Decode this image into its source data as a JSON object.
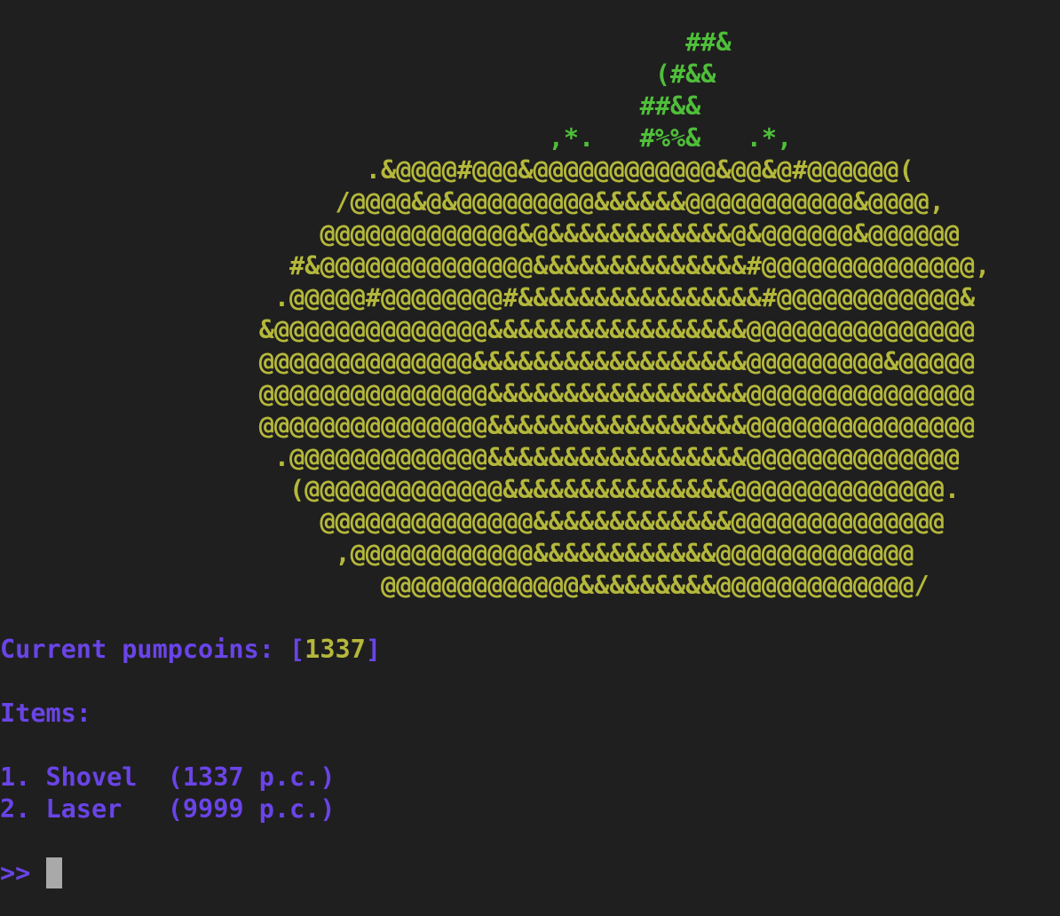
{
  "ascii_art": {
    "stem_lines": [
      "                                             ##&",
      "                                           (#&&",
      "                                          ##&&",
      "                                    ,*.   #%%&   .*,"
    ],
    "pumpkin_lines": [
      "                        .&@@@@#@@@&@@@@@@@@@@@@&@@&@#@@@@@@(",
      "                      /@@@@&@&@@@@@@@@@&&&&&&@@@@@@@@@@@&@@@@,",
      "                     @@@@@@@@@@@@@&@&&&&&&&&&&&&@&@@@@@@&@@@@@@",
      "                   #&@@@@@@@@@@@@@@&&&&&&&&&&&&&&#@@@@@@@@@@@@@@,",
      "                  .@@@@@#@@@@@@@@#&&&&&&&&&&&&&&&&#@@@@@@@@@@@@&",
      "                 &@@@@@@@@@@@@@@&&&&&&&&&&&&&&&&&@@@@@@@@@@@@@@@",
      "                 @@@@@@@@@@@@@@&&&&&&&&&&&&&&&&&&@@@@@@@@@&@@@@@",
      "                 @@@@@@@@@@@@@@@&&&&&&&&&&&&&&&&&@@@@@@@@@@@@@@@",
      "                 @@@@@@@@@@@@@@@&&&&&&&&&&&&&&&&&@@@@@@@@@@@@@@@",
      "                  .@@@@@@@@@@@@@&&&&&&&&&&&&&&&&&@@@@@@@@@@@@@@",
      "                   (@@@@@@@@@@@@@&&&&&&&&&&&&&&&@@@@@@@@@@@@@@.",
      "                     @@@@@@@@@@@@@@&&&&&&&&&&&&&@@@@@@@@@@@@@@",
      "                      ,@@@@@@@@@@@@&&&&&&&&&&&&@@@@@@@@@@@@@",
      "                         @@@@@@@@@@@@@&&&&&&&&&@@@@@@@@@@@@@/"
    ]
  },
  "coins": {
    "label": "Current pumpcoins: [",
    "value": "1337",
    "close": "]"
  },
  "items_title": "Items:",
  "items": [
    "1. Shovel  (1337 p.c.)",
    "2. Laser   (9999 p.c.)"
  ],
  "prompt": ">> ",
  "colors": {
    "background": "#1f1f1f",
    "stem": "#4fbf3a",
    "pumpkin": "#b5b83a",
    "text": "#6a44e8",
    "cursor": "#a9a9a9"
  }
}
